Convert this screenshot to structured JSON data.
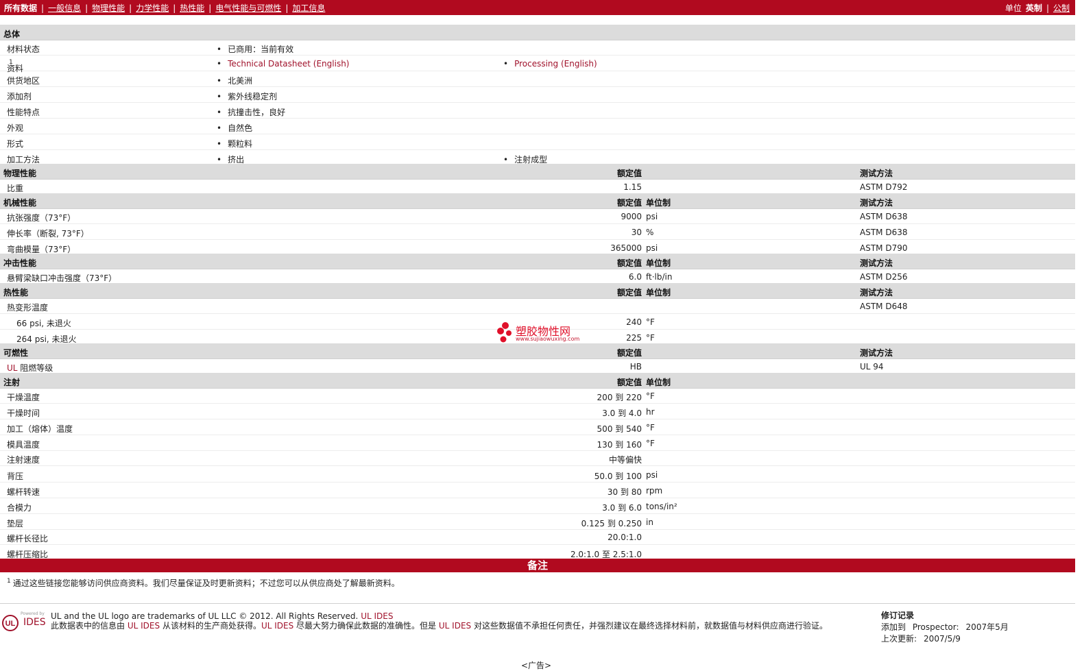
{
  "nav": {
    "tabs": [
      "所有数据",
      "一般信息",
      "物理性能",
      "力学性能",
      "热性能",
      "电气性能与可燃性",
      "加工信息"
    ],
    "units_label": "单位",
    "units_current": "英制",
    "units_alt": "公制"
  },
  "general": {
    "title": "总体",
    "rows": [
      {
        "label": "材料状态",
        "v1": "已商用：当前有效"
      },
      {
        "label": "资料",
        "sup": "1",
        "v1": "Technical Datasheet (English)",
        "v2": "Processing (English)"
      },
      {
        "label": "供货地区",
        "v1": "北美洲"
      },
      {
        "label": "添加剂",
        "v1": "紫外线稳定剂"
      },
      {
        "label": "性能特点",
        "v1": "抗撞击性，良好"
      },
      {
        "label": "外观",
        "v1": "自然色"
      },
      {
        "label": "形式",
        "v1": "颗粒料"
      },
      {
        "label": "加工方法",
        "v1": "挤出",
        "v2": "注射成型"
      }
    ]
  },
  "physical": {
    "title": "物理性能",
    "h_value": "额定值",
    "h_test": "测试方法",
    "rows": [
      {
        "label": "比重",
        "value": "1.15",
        "test": "ASTM D792"
      }
    ]
  },
  "mechanical": {
    "title": "机械性能",
    "h_value": "额定值",
    "h_unit": "单位制",
    "h_test": "测试方法",
    "rows": [
      {
        "label": "抗张强度（73°F）",
        "value": "9000",
        "unit": "psi",
        "test": "ASTM D638"
      },
      {
        "label": "伸长率（断裂, 73°F）",
        "value": "30",
        "unit": "%",
        "test": "ASTM D638"
      },
      {
        "label": "弯曲模量（73°F）",
        "value": "365000",
        "unit": "psi",
        "test": "ASTM D790"
      }
    ]
  },
  "impact": {
    "title": "冲击性能",
    "h_value": "额定值",
    "h_unit": "单位制",
    "h_test": "测试方法",
    "rows": [
      {
        "label": "悬臂梁缺口冲击强度（73°F）",
        "value": "6.0",
        "unit": "ft·lb/in",
        "test": "ASTM D256"
      }
    ]
  },
  "thermal": {
    "title": "热性能",
    "h_value": "额定值",
    "h_unit": "单位制",
    "h_test": "测试方法",
    "rows": [
      {
        "label": "热变形温度",
        "test": "ASTM D648"
      },
      {
        "label": "66 psi, 未退火",
        "value": "240",
        "unit": "°F"
      },
      {
        "label": "264 psi, 未退火",
        "value": "225",
        "unit": "°F"
      }
    ]
  },
  "flammability": {
    "title": "可燃性",
    "h_value": "额定值",
    "h_test": "测试方法",
    "rows": [
      {
        "label_prefix": "UL",
        "label": "阻燃等级",
        "value": "HB",
        "test": "UL 94"
      }
    ]
  },
  "injection": {
    "title": "注射",
    "h_value": "额定值",
    "h_unit": "单位制",
    "rows": [
      {
        "label": "干燥温度",
        "value": "200 到  220",
        "unit": "°F"
      },
      {
        "label": "干燥时间",
        "value": "3.0 到  4.0",
        "unit": "hr"
      },
      {
        "label": "加工（熔体）温度",
        "value": "500 到  540",
        "unit": "°F"
      },
      {
        "label": "模具温度",
        "value": "130 到  160",
        "unit": "°F"
      },
      {
        "label": "注射速度",
        "value": "中等偏快"
      },
      {
        "label": "背压",
        "value": "50.0 到  100",
        "unit": "psi"
      },
      {
        "label": "螺杆转速",
        "value": "30 到  80",
        "unit": "rpm"
      },
      {
        "label": "合模力",
        "value": "3.0 到  6.0",
        "unit": "tons/in²"
      },
      {
        "label": "垫层",
        "value": "0.125 到  0.250",
        "unit": "in"
      },
      {
        "label": "螺杆长径比",
        "value": "20.0:1.0"
      },
      {
        "label": "螺杆压缩比",
        "value": "2.0:1.0 至  2.5:1.0"
      }
    ]
  },
  "notes": {
    "title": "备注",
    "num": "1",
    "text": "通过这些链接您能够访问供应商资料。我们尽量保证及时更新资料；不过您可以从供应商处了解最新资料。"
  },
  "footer": {
    "logo_small": "Powered by",
    "logo_main": "IDES",
    "copyright": "UL and the UL logo are trademarks of UL LLC © 2012. All Rights Reserved.",
    "copyright_link": "UL IDES",
    "disclaimer_1": "此数据表中的信息由",
    "brand": "UL IDES",
    "disclaimer_2": "从该材料的生产商处获得。",
    "disclaimer_3": "尽最大努力确保此数据的准确性。但是",
    "disclaimer_4": "对这些数据值不承担任何责任，并强烈建议在最终选择材料前，就数据值与材料供应商进行验证。",
    "revision_title": "修订记录",
    "added_label": "添加到",
    "added_where": "Prospector:",
    "added_date": "2007年5月",
    "updated_label": "上次更新:",
    "updated_date": "2007/5/9",
    "ad": "<广告>"
  },
  "watermark": {
    "name": "塑胶物性网",
    "url": "www.sujiaowuxing.com"
  },
  "colors": {
    "brand": "#b10a1f",
    "link": "#a0112a",
    "header_bg": "#dcdcdc"
  }
}
